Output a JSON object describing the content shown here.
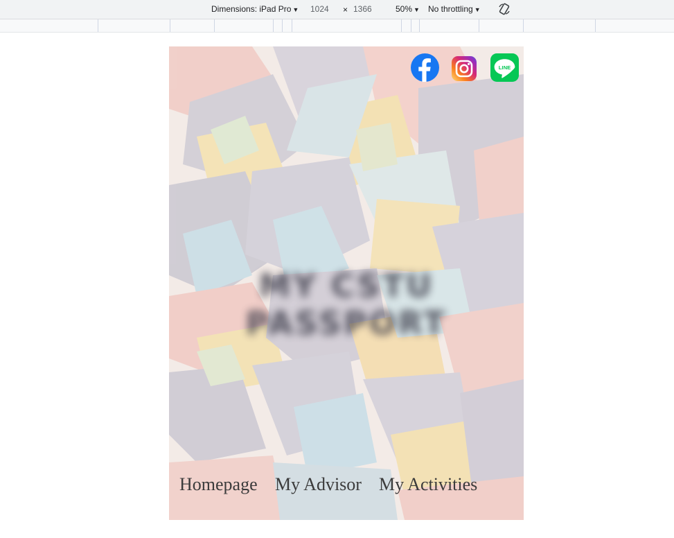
{
  "devtools": {
    "dimensions_label": "Dimensions: iPad Pro",
    "width": "1024",
    "times": "×",
    "height": "1366",
    "zoom": "50%",
    "throttling": "No throttling",
    "caret": "▼",
    "rotate_icon": "rotate-icon"
  },
  "page": {
    "social": [
      {
        "name": "facebook",
        "color": "#1877f2"
      },
      {
        "name": "instagram",
        "color": "#e1306c"
      },
      {
        "name": "line",
        "color": "#06c755",
        "text": "LINE"
      }
    ],
    "blurred_title": "MY CSTU PASSPORT",
    "nav": [
      "Homepage",
      "My Advisor",
      "My Activities"
    ]
  }
}
